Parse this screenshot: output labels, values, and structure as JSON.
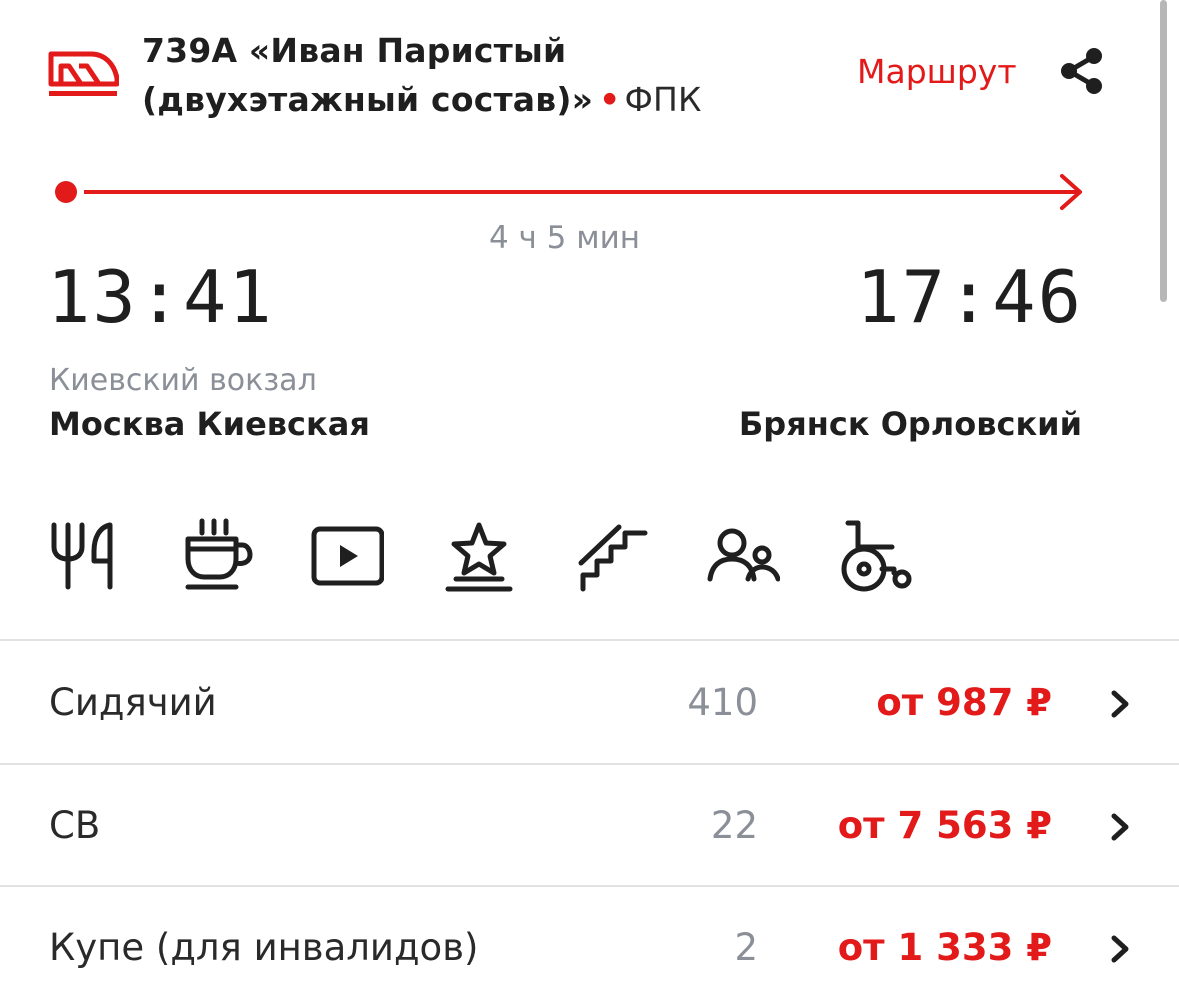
{
  "header": {
    "train_title": "739А «Иван Паристый (двухэтажный состав)»",
    "dot": "•",
    "carrier": "ФПК",
    "route_link": "Маршрут",
    "logo_icon": "rzd-train-logo-icon",
    "share_icon": "share-icon"
  },
  "trip": {
    "duration": "4 ч 5 мин",
    "departure": {
      "time": "13:41",
      "station_sub": "Киевский вокзал",
      "station": "Москва Киевская"
    },
    "arrival": {
      "time": "17:46",
      "station": "Брянск Орловский"
    }
  },
  "amenities": [
    {
      "icon": "restaurant-icon"
    },
    {
      "icon": "hot-drinks-icon"
    },
    {
      "icon": "multimedia-icon"
    },
    {
      "icon": "brand-star-icon"
    },
    {
      "icon": "double-deck-stairs-icon"
    },
    {
      "icon": "family-icon"
    },
    {
      "icon": "wheelchair-icon"
    }
  ],
  "car_classes": [
    {
      "name": "Сидячий",
      "seats": "410",
      "price": "от 987 ₽"
    },
    {
      "name": "СВ",
      "seats": "22",
      "price": "от 7 563 ₽"
    },
    {
      "name": "Купе (для инвалидов)",
      "seats": "2",
      "price": "от 1 333 ₽"
    }
  ],
  "colors": {
    "accent": "#e21a1a",
    "text": "#1f1f1f",
    "muted": "#8a8f98",
    "divider": "#e2e2e2"
  }
}
